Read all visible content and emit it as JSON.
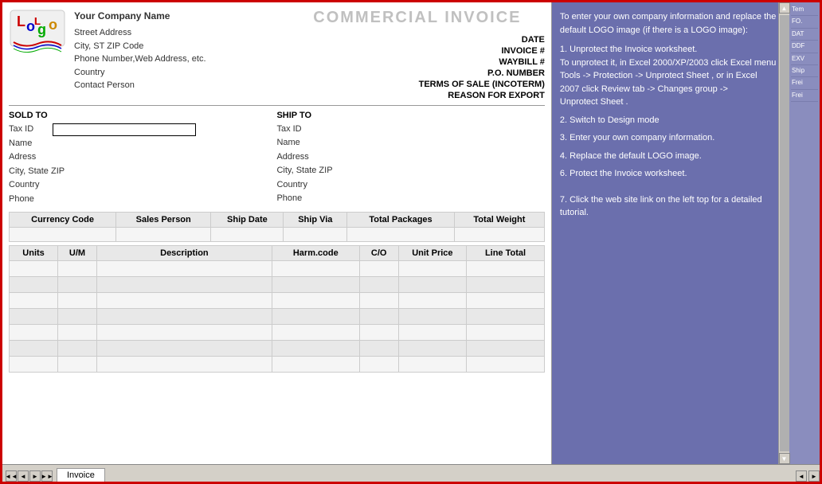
{
  "header": {
    "title": "COMMERCIAL INVOICE",
    "logo_text": "Logo",
    "company_name": "Your Company Name",
    "address_line1": "Street Address",
    "address_line2": "City, ST ZIP Code",
    "address_line3": "Phone Number,Web Address, etc.",
    "address_line4": "Country",
    "address_line5": "Contact Person"
  },
  "fields": {
    "date_label": "DATE",
    "invoice_label": "INVOICE #",
    "waybill_label": "WAYBILL #",
    "po_label": "P.O. NUMBER",
    "terms_label": "TERMS OF SALE (INCOTERM)",
    "reason_label": "REASON FOR EXPORT"
  },
  "sold_to": {
    "header": "SOLD TO",
    "tax_id": "Tax ID",
    "name": "Name",
    "address": "Adress",
    "city_state": "City, State ZIP",
    "country": "Country",
    "phone": "Phone"
  },
  "ship_to": {
    "header": "SHIP TO",
    "tax_id": "Tax ID",
    "name": "Name",
    "address": "Address",
    "city_state": "City, State ZIP",
    "country": "Country",
    "phone": "Phone"
  },
  "shipping_table": {
    "headers": [
      "Currency Code",
      "Sales Person",
      "Ship Date",
      "Ship Via",
      "Total Packages",
      "Total Weight"
    ]
  },
  "items_table": {
    "headers": [
      "Units",
      "U/M",
      "Description",
      "Harm.code",
      "C/O",
      "Unit Price",
      "Line Total"
    ]
  },
  "sidebar": {
    "intro": "To enter your own company information and replace the default LOGO image (if there is a LOGO image):",
    "step1_title": "1. Unprotect the Invoice worksheet.",
    "step1_body": "To unprotect it, in Excel 2000/XP/2003 click Excel menu Tools -> Protection ->",
    "step1_bold1": "Unprotect Sheet",
    "step1_mid": ", or in Excel 2007 click",
    "step1_bold2": "Review",
    "step1_tab": "tab ->",
    "step1_bold3": "Changes",
    "step1_group": "group ->",
    "step1_bold4": "Unprotect Sheet",
    "step2": "2. Switch to",
    "step2_bold": "Design",
    "step2_mode": "mode",
    "step3": "3. Enter your own company information.",
    "step4": "4. Replace the default LOGO image.",
    "step6": "6. Protect the",
    "step6_bold": "Invoice",
    "step6_end": "worksheet.",
    "step7": "7. Click the web site link on the left top for a detailed tutorial.",
    "right_panel": [
      "Tem",
      "FO.",
      "DAT",
      "DDF",
      "EXV",
      "Ship",
      "Frei",
      "Frei"
    ]
  },
  "tabs": {
    "invoice_tab": "Invoice"
  },
  "nav": {
    "first": "◄◄",
    "prev": "◄",
    "next": "►",
    "last": "►►"
  },
  "scroll": {
    "up": "▲",
    "down": "▼",
    "left": "◄",
    "right": "►"
  }
}
